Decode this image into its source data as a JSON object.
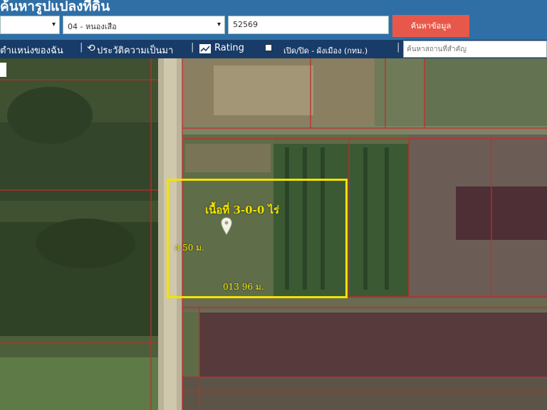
{
  "header": {
    "title": "ค้นหารูปแปลงที่ดิน"
  },
  "filters": {
    "province_value": "",
    "amphoe_value": "04 - หนองเสือ",
    "parcel_number_value": "52569",
    "search_button_label": "ค้นหาข้อมูล"
  },
  "toolbar": {
    "items": [
      {
        "label": "ตำแหน่งของฉัน",
        "icon": "location-icon"
      },
      {
        "label": "ประวัติความเป็นมา",
        "icon": "history-icon"
      },
      {
        "label": "Rating",
        "icon": "rating-icon"
      },
      {
        "label": "เปิด/ปิด - ผังเมือง (กทม.)",
        "icon": "checkbox-icon"
      }
    ],
    "find_placeholder": "ค้นหาสถานที่สำคัญ"
  },
  "map": {
    "parcel_area_label": "เนื้อที่ 3-0-0 ไร่",
    "frontage_label": "ก 50 ม.",
    "width_label": "013 96 ม.",
    "highlight_color": "#f2e300",
    "boundary_color": "#c62a2a"
  }
}
